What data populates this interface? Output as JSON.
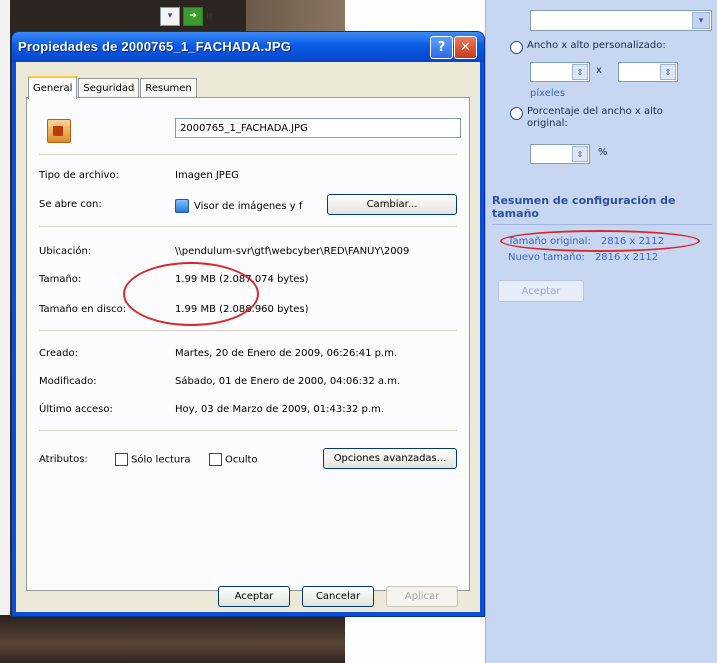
{
  "toolbar": {
    "label": "Ir"
  },
  "dialog": {
    "title": "Propiedades de 2000765_1_FACHADA.JPG",
    "help_label": "?",
    "close_label": "✕",
    "tabs": [
      "General",
      "Seguridad",
      "Resumen"
    ],
    "file_name": "2000765_1_FACHADA.JPG",
    "rows": {
      "tipo": {
        "label": "Tipo de archivo:",
        "value": "Imagen JPEG"
      },
      "abre": {
        "label": "Se abre con:",
        "value": "Visor de imágenes y f",
        "button": "Cambiar..."
      },
      "ubicacion": {
        "label": "Ubicación:",
        "value": "\\\\pendulum-svr\\gtf\\webcyber\\RED\\FANUY\\2009"
      },
      "tamano": {
        "label": "Tamaño:",
        "value": "1.99 MB (2.087.074 bytes)"
      },
      "tamano_disco": {
        "label": "Tamaño en disco:",
        "value": "1.99 MB (2.088.960 bytes)"
      },
      "creado": {
        "label": "Creado:",
        "value": "Martes, 20 de Enero de 2009, 06:26:41 p.m."
      },
      "modificado": {
        "label": "Modificado:",
        "value": "Sábado, 01 de Enero de 2000, 04:06:32 a.m."
      },
      "ultimo": {
        "label": "Último acceso:",
        "value": "Hoy, 03 de Marzo de 2009, 01:43:32 p.m."
      }
    },
    "attributes": {
      "label": "Atributos:",
      "readonly": "Sólo lectura",
      "hidden": "Oculto",
      "advanced": "Opciones avanzadas..."
    },
    "buttons": {
      "ok": "Aceptar",
      "cancel": "Cancelar",
      "apply": "Aplicar"
    }
  },
  "right_pane": {
    "dropdown_arrow": "▾",
    "option_custom": "Ancho x alto personalizado:",
    "times": "x",
    "pixels": "píxeles",
    "option_percent": "Porcentaje del ancho x alto original:",
    "percent_sign": "%",
    "section_title": "Resumen de configuración de tamaño",
    "original_label": "Tamaño original:",
    "original_value": "2816 x 2112",
    "new_label": "Nuevo tamaño:",
    "new_value": "2816 x 2112",
    "accept": "Aceptar"
  }
}
